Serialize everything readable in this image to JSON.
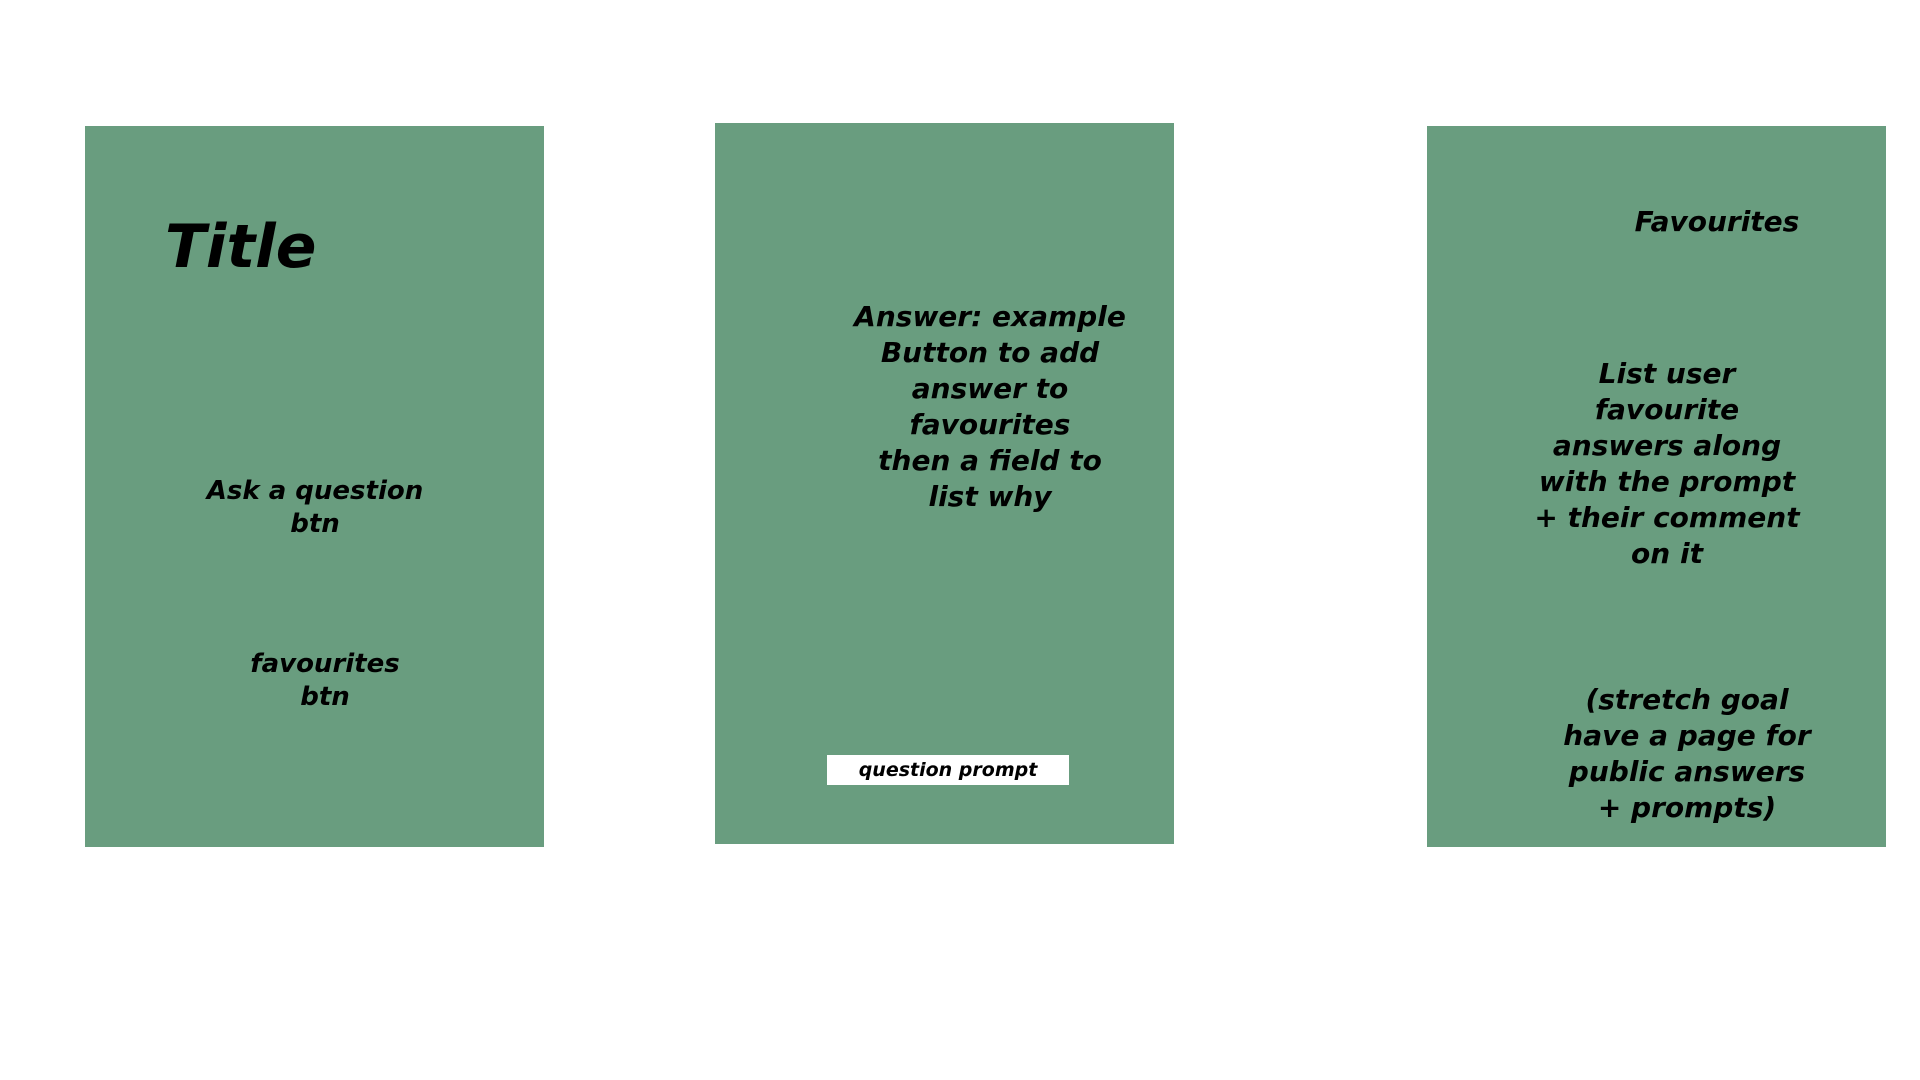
{
  "colors": {
    "panel": "#699d7f",
    "background": "#ffffff",
    "text": "#000000"
  },
  "panels": {
    "home": {
      "title": "Title",
      "ask_button": "Ask a question\nbtn",
      "favourites_button": "favourites\nbtn"
    },
    "answer": {
      "text": "Answer: example\nButton to add\nanswer to\nfavourites\nthen a field to\nlist why",
      "prompt_field": "question prompt"
    },
    "favourites": {
      "title": "Favourites",
      "description": "List user\nfavourite\nanswers along\nwith the prompt\n+ their comment\non it",
      "stretch_goal": "(stretch goal\nhave a page for\npublic answers\n+ prompts)"
    }
  }
}
